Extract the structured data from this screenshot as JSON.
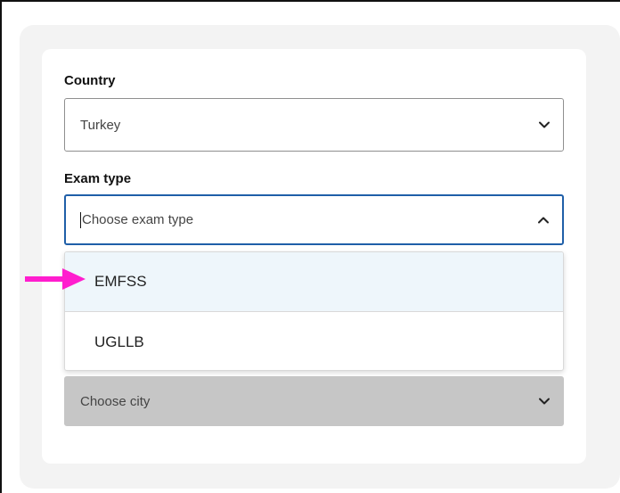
{
  "form": {
    "country": {
      "label": "Country",
      "value": "Turkey",
      "icon": "chevron-down-icon"
    },
    "exam_type": {
      "label": "Exam type",
      "placeholder": "Choose exam type",
      "icon": "chevron-up-icon",
      "options": [
        {
          "label": "EMFSS",
          "highlighted": true
        },
        {
          "label": "UGLLB",
          "highlighted": false
        }
      ]
    },
    "city": {
      "placeholder": "Choose city",
      "icon": "chevron-down-icon",
      "disabled": true
    }
  },
  "colors": {
    "focus_border": "#1f5fa8",
    "highlight_bg": "#eef6fb",
    "disabled_bg": "#c6c6c6",
    "annotation_arrow": "#ff1dce"
  }
}
